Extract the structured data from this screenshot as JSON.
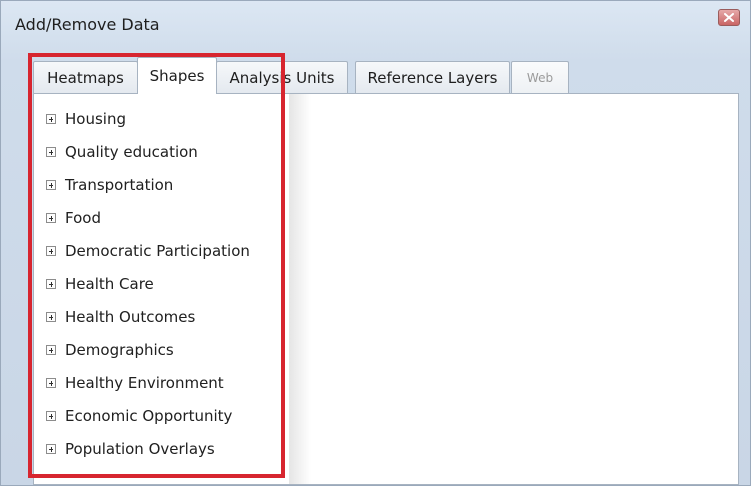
{
  "window": {
    "title": "Add/Remove Data",
    "close_icon": "close-icon"
  },
  "tabs": [
    {
      "label": "Heatmaps",
      "state": "normal"
    },
    {
      "label": "Shapes",
      "state": "active"
    },
    {
      "label": "Analysis Units",
      "state": "normal"
    },
    {
      "label": "Reference Layers",
      "state": "normal"
    },
    {
      "label": "Web",
      "state": "disabled"
    }
  ],
  "tree": {
    "expand_icon": "plus-square-icon",
    "items": [
      {
        "label": "Housing"
      },
      {
        "label": "Quality education"
      },
      {
        "label": "Transportation"
      },
      {
        "label": "Food"
      },
      {
        "label": "Democratic Participation"
      },
      {
        "label": "Health Care"
      },
      {
        "label": "Health Outcomes"
      },
      {
        "label": "Demographics"
      },
      {
        "label": "Healthy Environment"
      },
      {
        "label": "Economic Opportunity"
      },
      {
        "label": "Population Overlays"
      }
    ]
  },
  "annotation": {
    "highlight_color": "#d7252f"
  }
}
